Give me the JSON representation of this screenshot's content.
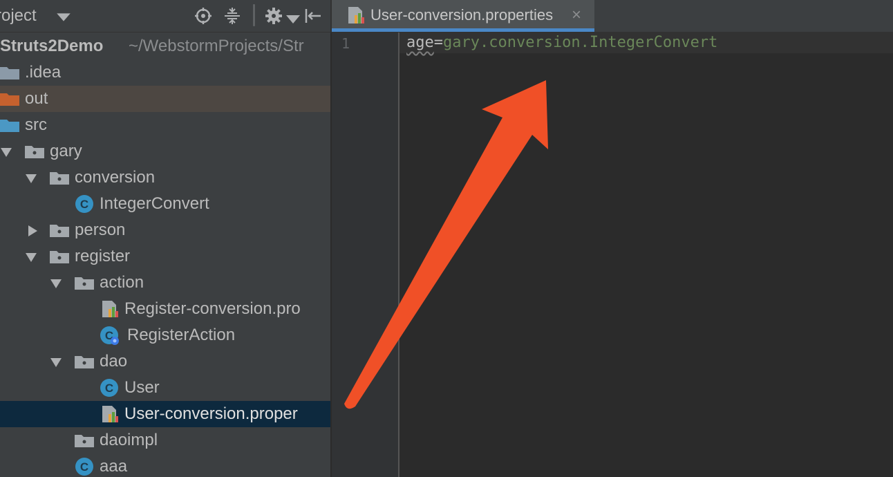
{
  "sidebar": {
    "title": "roject",
    "project_name": "Struts2Demo",
    "project_path": "~/WebstormProjects/Str",
    "items": [
      {
        "label": ".idea"
      },
      {
        "label": "out"
      },
      {
        "label": "src"
      },
      {
        "label": "gary"
      },
      {
        "label": "conversion"
      },
      {
        "label": "IntegerConvert"
      },
      {
        "label": "person"
      },
      {
        "label": "register"
      },
      {
        "label": "action"
      },
      {
        "label": "Register-conversion.pro"
      },
      {
        "label": "RegisterAction"
      },
      {
        "label": "dao"
      },
      {
        "label": "User"
      },
      {
        "label": "User-conversion.proper"
      },
      {
        "label": "daoimpl"
      },
      {
        "label": "aaa"
      }
    ]
  },
  "editor": {
    "tab_label": "User-conversion.properties",
    "tab_close": "×",
    "line_number": "1",
    "code_key": "age",
    "code_eq": "=",
    "code_value": "gary.conversion.IntegerConvert"
  },
  "icons": {
    "folder": "folder-icon",
    "package": "package-folder-icon",
    "class": "class-c-icon",
    "properties": "properties-file-icon"
  },
  "colors": {
    "selection": "#0d293e",
    "highlight": "#4d4742",
    "tab_accent": "#4a88c7",
    "string_value": "#6a8759",
    "annotation_arrow": "#f05027"
  }
}
